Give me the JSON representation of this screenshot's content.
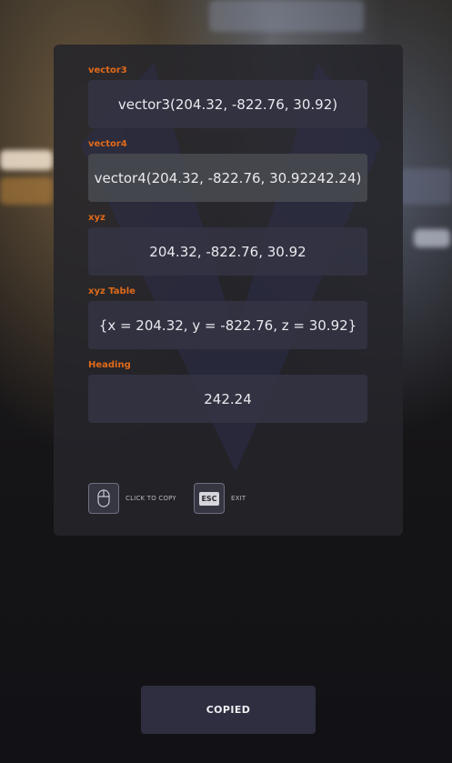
{
  "fields": [
    {
      "label": "vector3",
      "value": "vector3(204.32, -822.76, 30.92)"
    },
    {
      "label": "vector4",
      "value": "vector4(204.32, -822.76, 30.92242.24)"
    },
    {
      "label": "xyz",
      "value": "204.32, -822.76, 30.92"
    },
    {
      "label": "xyz Table",
      "value": "{x = 204.32, y = -822.76, z = 30.92}"
    },
    {
      "label": "Heading",
      "value": "242.24"
    }
  ],
  "hints": {
    "copy": {
      "icon": "mouse-icon",
      "label": "CLICK TO COPY"
    },
    "exit": {
      "icon": "esc-key-icon",
      "key": "ESC",
      "label": "EXIT"
    }
  },
  "status_button": {
    "label": "COPIED"
  },
  "colors": {
    "accent": "#e06a1a",
    "panel": "#24242a",
    "field": "#343444",
    "button": "#2e2e40"
  }
}
